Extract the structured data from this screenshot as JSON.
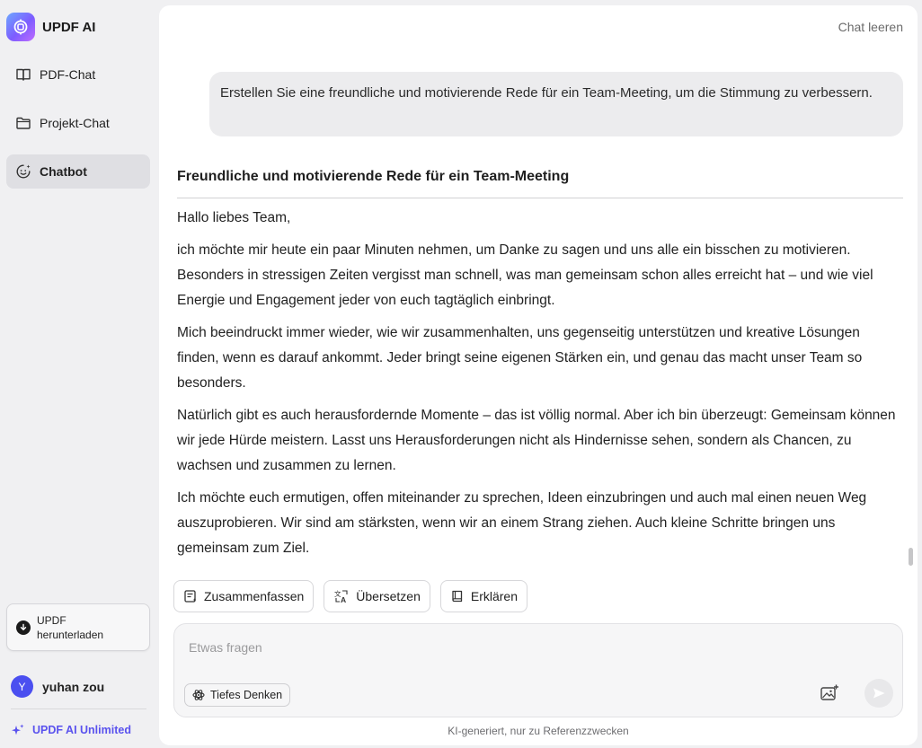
{
  "app": {
    "name": "UPDF AI"
  },
  "sidebar": {
    "items": [
      {
        "label": "PDF-Chat",
        "icon": "book-open-icon",
        "active": false
      },
      {
        "label": "Projekt-Chat",
        "icon": "folder-icon",
        "active": false
      },
      {
        "label": "Chatbot",
        "icon": "bot-face-icon",
        "active": true
      }
    ],
    "download_label": "UPDF herunterladen",
    "user": {
      "initial": "Y",
      "name": "yuhan zou"
    },
    "plan_label": "UPDF AI Unlimited"
  },
  "header": {
    "clear_chat_label": "Chat leeren"
  },
  "conversation": {
    "user_message": "Erstellen Sie eine freundliche und motivierende Rede für ein Team-Meeting, um die Stimmung zu verbessern.",
    "answer_title": "Freundliche und motivierende Rede für ein Team-Meeting",
    "paragraphs": [
      "Hallo liebes Team,",
      "ich möchte mir heute ein paar Minuten nehmen, um Danke zu sagen und uns alle ein bisschen zu motivieren. Besonders in stressigen Zeiten vergisst man schnell, was man gemeinsam schon alles erreicht hat – und wie viel Energie und Engagement jeder von euch tagtäglich einbringt.",
      "Mich beeindruckt immer wieder, wie wir zusammenhalten, uns gegenseitig unterstützen und kreative Lösungen finden, wenn es darauf ankommt. Jeder bringt seine eigenen Stärken ein, und genau das macht unser Team so besonders.",
      "Natürlich gibt es auch herausfordernde Momente – das ist völlig normal. Aber ich bin überzeugt: Gemeinsam können wir jede Hürde meistern. Lasst uns Herausforderungen nicht als Hindernisse sehen, sondern als Chancen, zu wachsen und zusammen zu lernen.",
      "Ich möchte euch ermutigen, offen miteinander zu sprechen, Ideen einzubringen und auch mal einen neuen Weg auszuprobieren. Wir sind am stärksten, wenn wir an einem Strang ziehen. Auch kleine Schritte bringen uns gemeinsam zum Ziel."
    ]
  },
  "actions": {
    "summarize_label": "Zusammenfassen",
    "translate_label": "Übersetzen",
    "explain_label": "Erklären"
  },
  "composer": {
    "placeholder": "Etwas fragen",
    "deep_think_label": "Tiefes Denken"
  },
  "footer": {
    "disclaimer": "KI-generiert, nur zu Referenzzwecken"
  },
  "colors": {
    "accent": "#5a52ee",
    "avatar": "#4b4ff0",
    "active_nav": "#dfdfe3"
  }
}
